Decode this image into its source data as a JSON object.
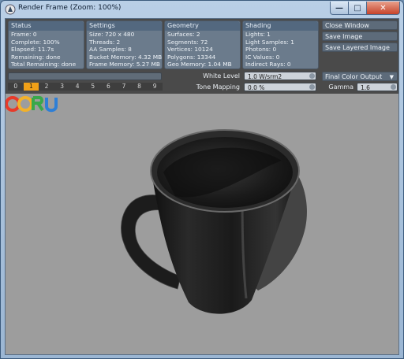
{
  "window": {
    "title": "Render Frame (Zoom: 100%)",
    "controls": {
      "minimize": "—",
      "maximize": "□",
      "close": "✕"
    }
  },
  "panels": {
    "status": {
      "title": "Status",
      "lines": [
        "Frame: 0",
        "Complete: 100%",
        "Elapsed: 11.7s",
        "Remaining: done",
        "Total Remaining: done"
      ]
    },
    "settings": {
      "title": "Settings",
      "lines": [
        "Size: 720 x 480",
        "Threads: 2",
        "AA Samples: 8",
        "Bucket Memory: 4.32 MB",
        "Frame Memory: 5.27 MB"
      ]
    },
    "geometry": {
      "title": "Geometry",
      "lines": [
        "Surfaces: 2",
        "Segments: 72",
        "Vertices: 10124",
        "Polygons: 13344",
        "Geo Memory: 1.04 MB"
      ]
    },
    "shading": {
      "title": "Shading",
      "lines": [
        "Lights: 1",
        "Light Samples: 1",
        "Photons: 0",
        "IC Values: 0",
        "Indirect Rays: 0"
      ]
    }
  },
  "actions": {
    "close_window": "Close Window",
    "save_image": "Save Image",
    "save_layered": "Save Layered Image"
  },
  "frames": [
    "0",
    "1",
    "2",
    "3",
    "4",
    "5",
    "6",
    "7",
    "8",
    "9"
  ],
  "active_frame": "1",
  "controls": {
    "white_level_label": "White Level",
    "white_level_value": "1.0 W/srm2",
    "tone_mapping_label": "Tone Mapping",
    "tone_mapping_value": "0.0 %",
    "output_select": "Final Color Output",
    "gamma_label": "Gamma",
    "gamma_value": "1.6"
  },
  "progress": 1.0,
  "colors": {
    "active_frame": "#f0a018",
    "panel_bg": "#6b7b8c",
    "viewport_bg": "#9d9d9d"
  },
  "logo": {
    "text": "CGRU"
  }
}
